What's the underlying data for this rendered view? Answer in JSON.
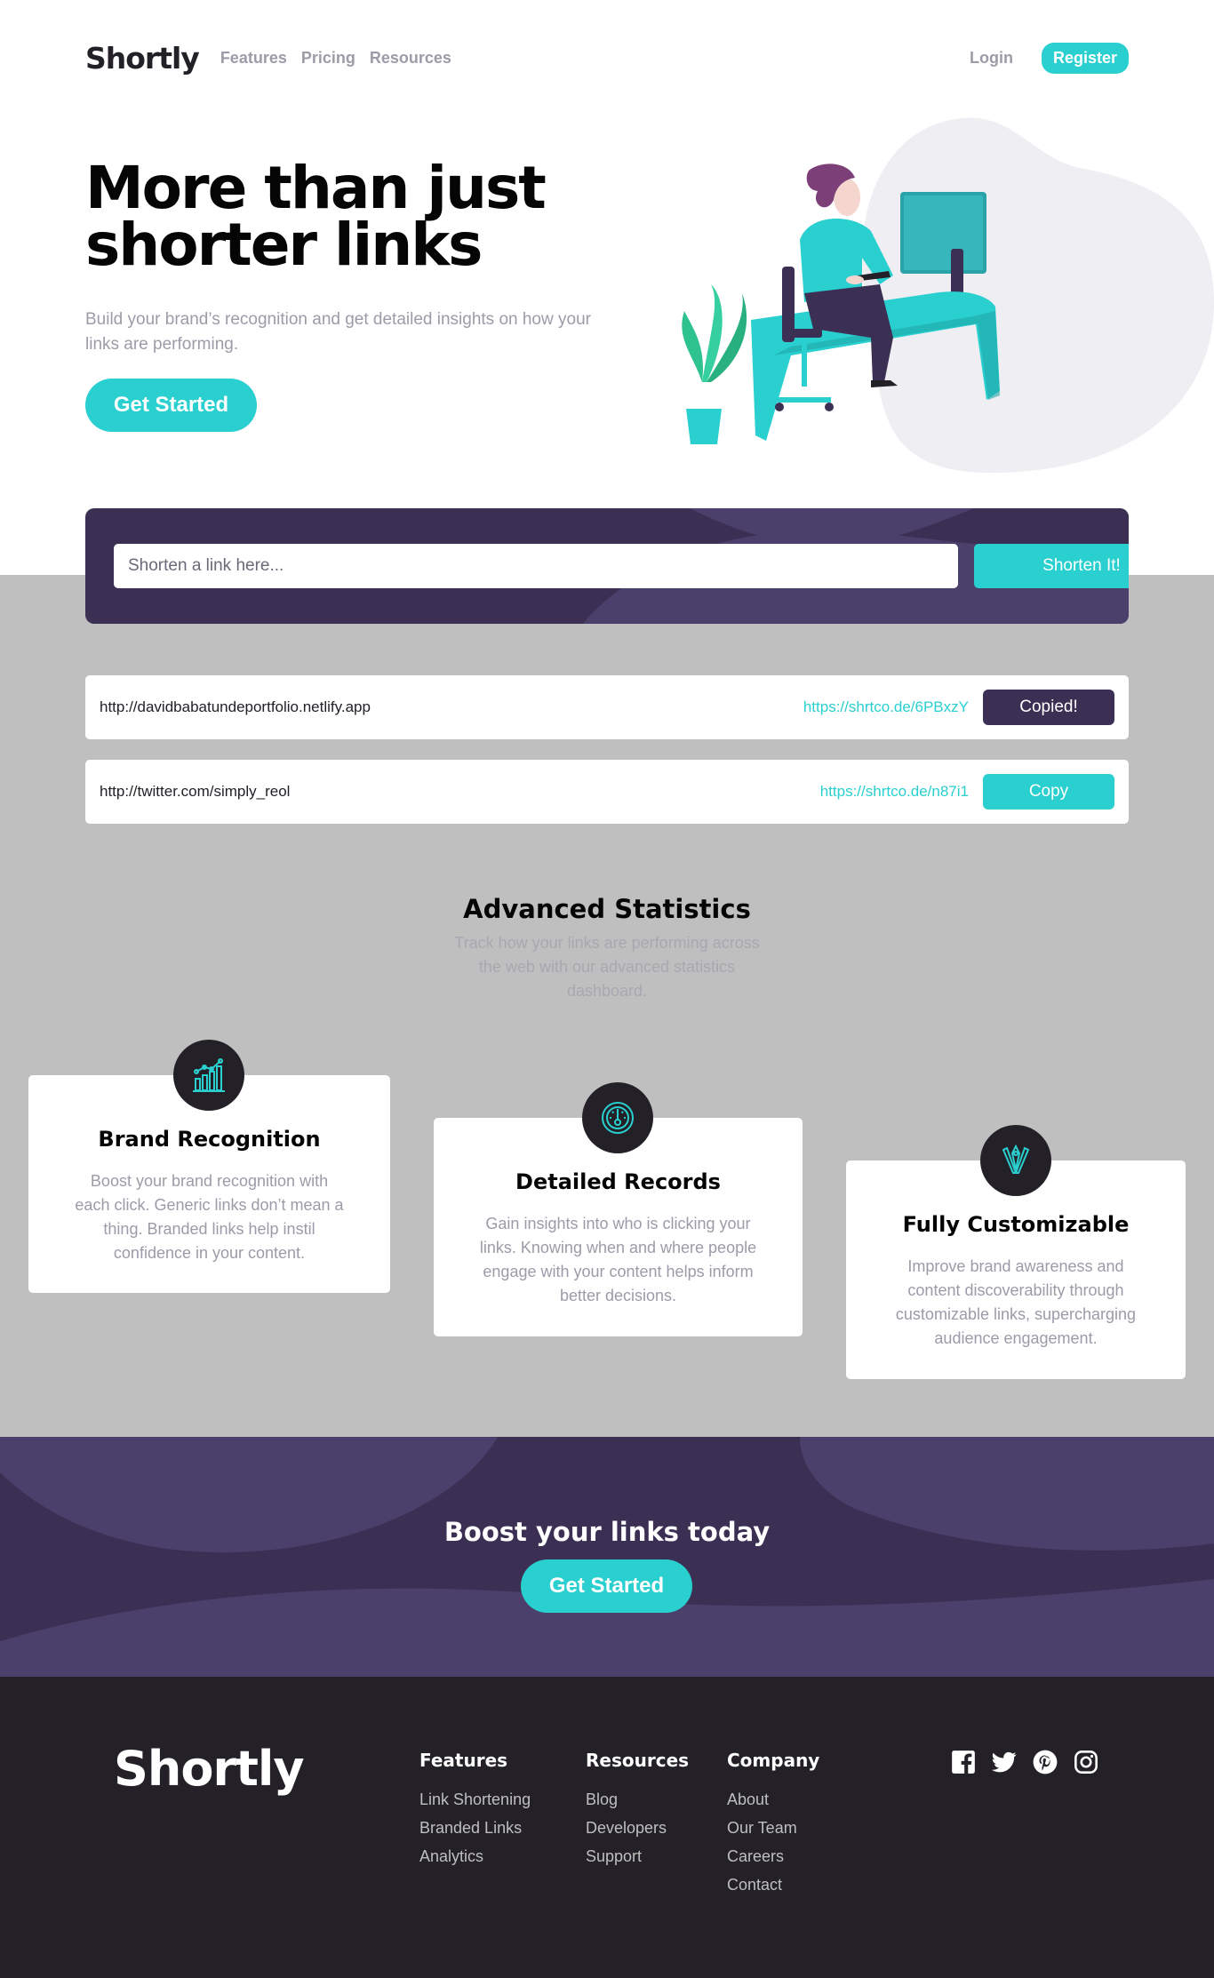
{
  "colors": {
    "primary": "#2acfcf",
    "dark_violet": "#3b3054",
    "very_dark": "#232127",
    "grey": "#bfbfbf",
    "gray_text": "#9e9aa8"
  },
  "header": {
    "logo": "Shortly",
    "nav": [
      "Features",
      "Pricing",
      "Resources"
    ],
    "login": "Login",
    "register": "Register"
  },
  "hero": {
    "title_line1": "More than just",
    "title_line2": "shorter links",
    "subtitle_line1": "Build your brand’s recognition and get detailed insights on how your",
    "subtitle_line2": "links are performing.",
    "cta": "Get Started"
  },
  "shorten": {
    "placeholder": "Shorten a link here...",
    "button": "Shorten It!"
  },
  "results": [
    {
      "original": "http://davidbabatundeportfolio.netlify.app",
      "short": "https://shrtco.de/6PBxzY",
      "button": "Copied!",
      "state": "copied"
    },
    {
      "original": "http://twitter.com/simply_reol",
      "short": "https://shrtco.de/n87i1",
      "button": "Copy",
      "state": "idle"
    }
  ],
  "stats": {
    "title": "Advanced Statistics",
    "subtitle_lines": [
      "Track how your links are performing across",
      "the web with our advanced statistics",
      "dashboard."
    ],
    "cards": [
      {
        "title": "Brand Recognition",
        "icon": "brand-recognition-icon",
        "lines": [
          "Boost your brand recognition with",
          "each click. Generic links don’t mean a",
          "thing. Branded links help instil",
          "confidence in your content."
        ]
      },
      {
        "title": "Detailed Records",
        "icon": "detailed-records-icon",
        "lines": [
          "Gain insights into who is clicking your",
          "links. Knowing when and where people",
          "engage with your content helps inform",
          "better decisions."
        ]
      },
      {
        "title": "Fully Customizable",
        "icon": "fully-customizable-icon",
        "lines": [
          "Improve brand awareness and",
          "content discoverability through",
          "customizable links, supercharging",
          "audience engagement."
        ]
      }
    ]
  },
  "boost": {
    "title": "Boost your links today",
    "cta": "Get Started"
  },
  "footer": {
    "logo": "Shortly",
    "columns": [
      {
        "title": "Features",
        "links": [
          "Link Shortening",
          "Branded Links",
          "Analytics"
        ]
      },
      {
        "title": "Resources",
        "links": [
          "Blog",
          "Developers",
          "Support"
        ]
      },
      {
        "title": "Company",
        "links": [
          "About",
          "Our Team",
          "Careers",
          "Contact"
        ]
      }
    ],
    "socials": [
      "facebook-icon",
      "twitter-icon",
      "pinterest-icon",
      "instagram-icon"
    ]
  }
}
